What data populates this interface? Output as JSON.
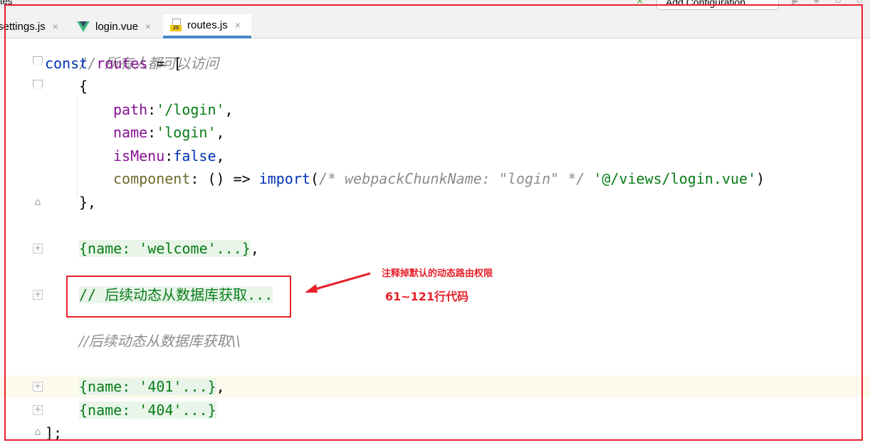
{
  "toolbar": {
    "window_title_fragment": "tes",
    "add_configuration_label": "Add Configuration..."
  },
  "tabs": [
    {
      "label": "settings.js",
      "close": "×",
      "active": false
    },
    {
      "label": "login.vue",
      "close": "×",
      "active": false
    },
    {
      "label": "routes.js",
      "close": "×",
      "active": true
    }
  ],
  "code": {
    "line0": "// 所有人都可以访问",
    "line1_kw": "const",
    "line1_var": "routes",
    "line1_rest": " = [",
    "line2": "{",
    "line3_key": "path",
    "line3_val": "'/login'",
    "line4_key": "name",
    "line4_val": "'login'",
    "line5_key": "isMenu",
    "line5_val": "false",
    "line6_key": "component",
    "line6_mid": ": () => ",
    "line6_fn": "import",
    "line6_comment": "/* webpackChunkName: \"login\" */",
    "line6_str": "'@/views/login.vue'",
    "line7": "},",
    "line8_fold": "{name: 'welcome'...}",
    "line8_tail": ",",
    "line9_fold": "// 后续动态从数据库获取...",
    "line10_comment": "//后续动态从数据库获取\\\\",
    "line11_fold": "{name: '401'...}",
    "line11_tail": ",",
    "line12_fold": "{name: '404'...}",
    "line13": "];"
  },
  "annotation": {
    "note_line1": "注释掉默认的动态路由权限",
    "note_line2": "61~121行代码",
    "color": "#e8202a"
  }
}
